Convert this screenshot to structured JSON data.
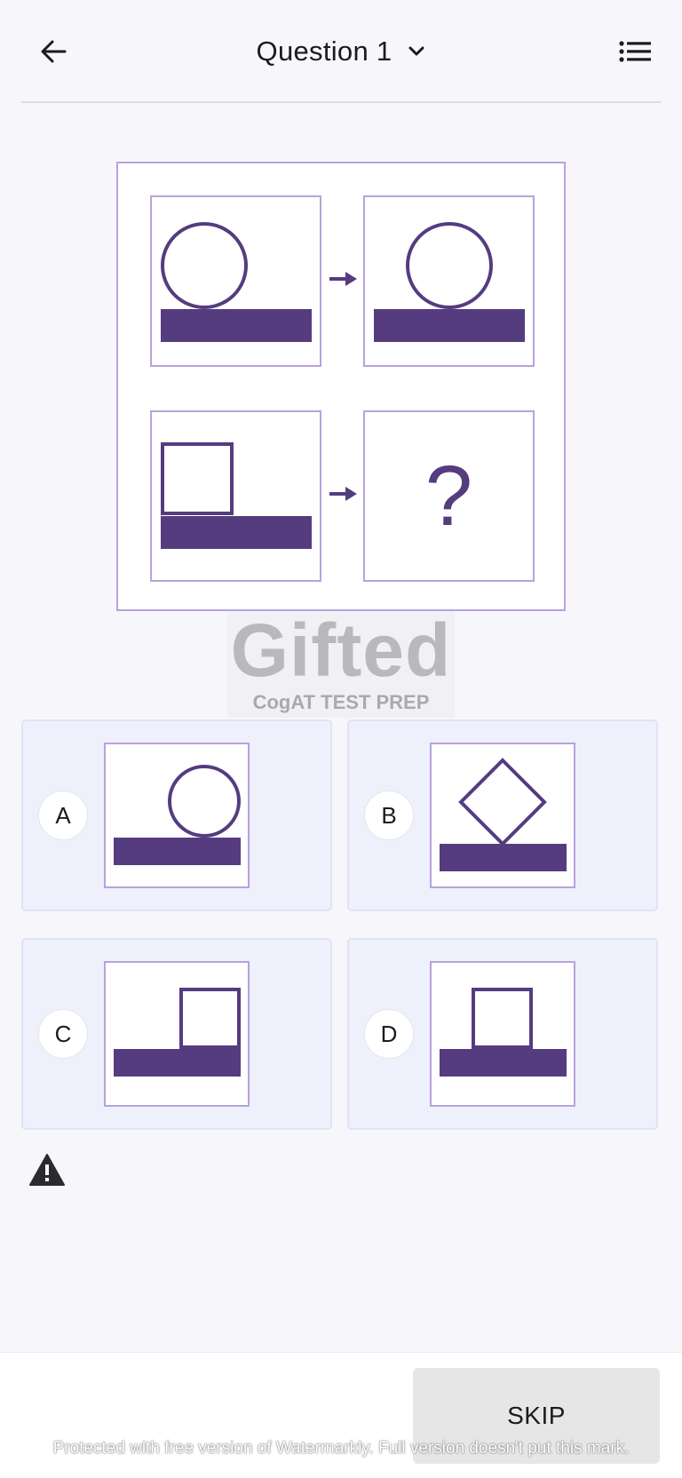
{
  "header": {
    "title": "Question 1",
    "back_icon": "arrow-left-icon",
    "dropdown_icon": "chevron-down-icon",
    "menu_icon": "list-icon"
  },
  "question": {
    "placeholder_symbol": "?"
  },
  "logo": {
    "word": "Gifted",
    "subtitle": "CogAT TEST PREP"
  },
  "options": [
    {
      "letter": "A"
    },
    {
      "letter": "B"
    },
    {
      "letter": "C"
    },
    {
      "letter": "D"
    }
  ],
  "warning_icon": "warning-triangle-icon",
  "footer": {
    "skip_label": "SKIP",
    "watermark_text": "Protected with free version of Watermarkly. Full version doesn't put this mark."
  },
  "colors": {
    "shape": "#553c7f",
    "frame": "#b9a2dc",
    "option_bg": "#eef0fb",
    "skip_bg": "#e6e6e6"
  }
}
